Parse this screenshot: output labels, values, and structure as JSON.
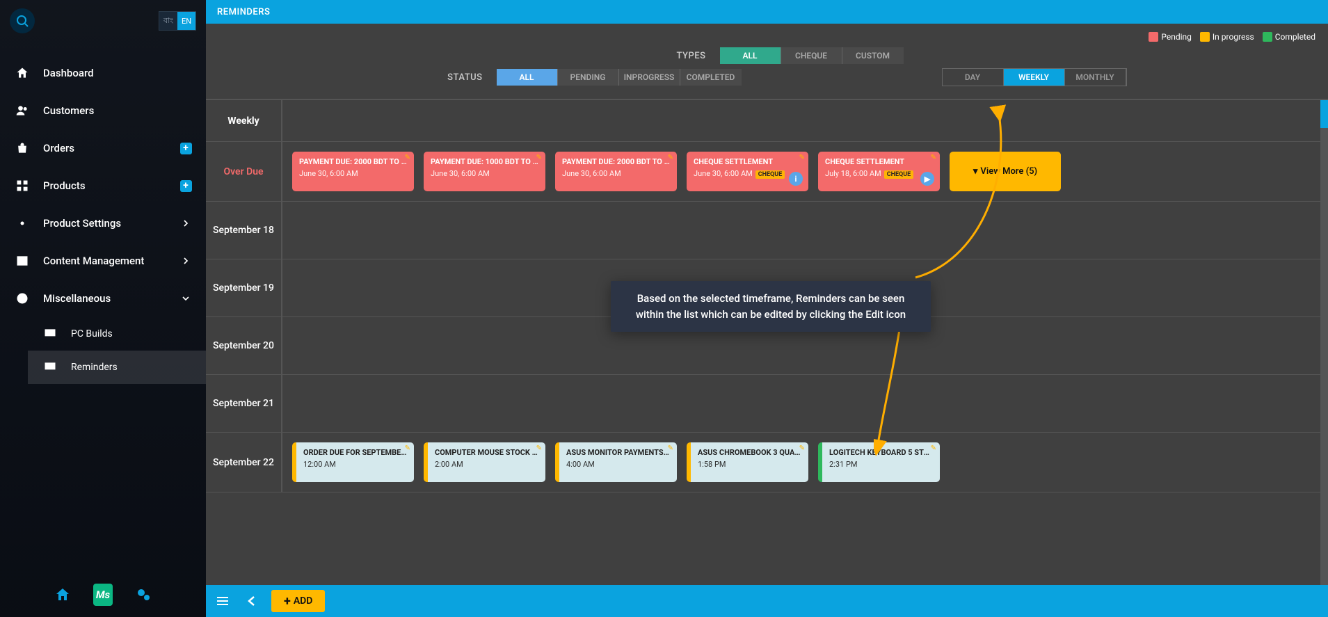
{
  "header": {
    "title": "REMINDERS"
  },
  "lang": {
    "bn": "বাং",
    "en": "EN"
  },
  "sidebar": {
    "items": [
      {
        "label": "Dashboard"
      },
      {
        "label": "Customers"
      },
      {
        "label": "Orders"
      },
      {
        "label": "Products"
      },
      {
        "label": "Product Settings"
      },
      {
        "label": "Content Management"
      },
      {
        "label": "Miscellaneous"
      }
    ],
    "sub": [
      {
        "label": "PC Builds"
      },
      {
        "label": "Reminders"
      }
    ]
  },
  "legend": {
    "pending": {
      "label": "Pending",
      "color": "#f36a6a"
    },
    "inprogress": {
      "label": "In progress",
      "color": "#ffb800"
    },
    "completed": {
      "label": "Completed",
      "color": "#2eb85c"
    }
  },
  "filters": {
    "types_label": "TYPES",
    "types": [
      "ALL",
      "CHEQUE",
      "CUSTOM"
    ],
    "status_label": "STATUS",
    "status": [
      "ALL",
      "PENDING",
      "INPROGRESS",
      "COMPLETED"
    ],
    "views": [
      "DAY",
      "WEEKLY",
      "MONTHLY"
    ]
  },
  "grid": {
    "header": "Weekly",
    "rows": [
      {
        "label": "Over Due",
        "overdue": true,
        "cards": [
          {
            "style": "red",
            "title": "PAYMENT DUE: 2000 BDT TO G...",
            "sub": "June 30, 6:00 AM",
            "edit": true
          },
          {
            "style": "red",
            "title": "PAYMENT DUE: 1000 BDT TO G...",
            "sub": "June 30, 6:00 AM",
            "edit": true
          },
          {
            "style": "red",
            "title": "PAYMENT DUE: 2000 BDT TO G...",
            "sub": "June 30, 6:00 AM",
            "edit": true
          },
          {
            "style": "red",
            "title": "CHEQUE SETTLEMENT",
            "sub": "June 30, 6:00 AM",
            "edit": true,
            "cheque": "CHEQUE",
            "round": "i"
          },
          {
            "style": "red",
            "title": "CHEQUE SETTLEMENT",
            "sub": "July 18, 6:00 AM",
            "edit": true,
            "cheque": "CHEQUE",
            "round": "▶"
          }
        ],
        "viewmore": "View More (5)"
      },
      {
        "label": "September 18",
        "cards": []
      },
      {
        "label": "September 19",
        "cards": []
      },
      {
        "label": "September 20",
        "cards": []
      },
      {
        "label": "September 21",
        "cards": []
      },
      {
        "label": "September 22",
        "cards": [
          {
            "style": "light",
            "bar": "yellow",
            "title": "ORDER DUE FOR SEPTEMBER ...",
            "sub": "12:00 AM",
            "edit": true
          },
          {
            "style": "light",
            "bar": "yellow",
            "title": "COMPUTER MOUSE STOCK PA...",
            "sub": "2:00 AM",
            "edit": true
          },
          {
            "style": "light",
            "bar": "yellow",
            "title": "ASUS MONITOR PAYMENTS 2 S...",
            "sub": "4:00 AM",
            "edit": true
          },
          {
            "style": "light",
            "bar": "yellow",
            "title": "ASUS CHROMEBOOK 3 QUAN...",
            "sub": "1:58 PM",
            "edit": true
          },
          {
            "style": "light",
            "bar": "green",
            "title": "LOGITECH KEYBOARD 5 STOC...",
            "sub": "2:31 PM",
            "edit": true
          }
        ]
      }
    ]
  },
  "tooltip": "Based on the selected timeframe, Reminders can be seen within the list which can be edited by clicking the Edit icon",
  "footer": {
    "add": "ADD"
  }
}
